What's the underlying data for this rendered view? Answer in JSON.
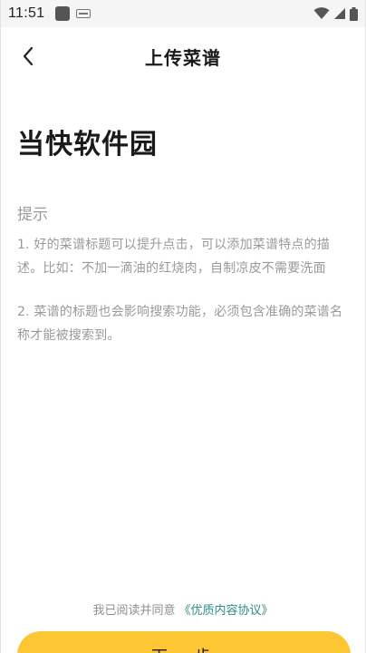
{
  "status_bar": {
    "time": "11:51",
    "icons": [
      "app-notification-icon",
      "keyboard-icon",
      "wifi-icon",
      "signal-icon",
      "battery-icon"
    ]
  },
  "header": {
    "title": "上传菜谱",
    "back_icon": "chevron-left-icon"
  },
  "recipe": {
    "title": "当快软件园"
  },
  "tips": {
    "heading": "提示",
    "items": [
      "1. 好的菜谱标题可以提升点击，可以添加菜谱特点的描述。比如：不加一滴油的红烧肉，自制凉皮不需要洗面",
      "2. 菜谱的标题也会影响搜索功能，必须包含准确的菜谱名称才能被搜索到。"
    ]
  },
  "footer": {
    "agreement_text": "我已阅读并同意",
    "agreement_link": "《优质内容协议》",
    "next_button_label": "下一步"
  },
  "colors": {
    "accent": "#fdc733",
    "link": "#2f8a8e",
    "muted_text": "#9a9a9a",
    "primary_text": "#1a1a1a"
  }
}
